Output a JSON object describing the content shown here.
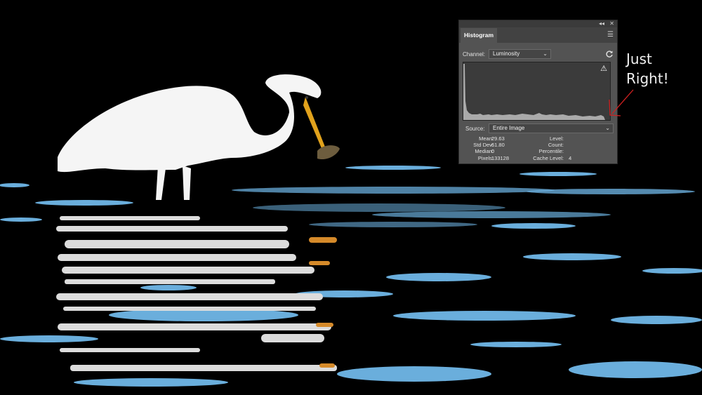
{
  "panel": {
    "tab_title": "Histogram",
    "collapse_glyph": "◂◂",
    "close_glyph": "✕",
    "menu_glyph": "☰",
    "channel_label": "Channel:",
    "channel_value": "Luminosity",
    "refresh_icon": "refresh-icon",
    "warning_glyph": "⚠",
    "source_label": "Source:",
    "source_value": "Entire Image",
    "stats": {
      "mean_label": "Mean:",
      "mean": "29.63",
      "stddev_label": "Std Dev:",
      "stddev": "61.80",
      "median_label": "Median:",
      "median": "0",
      "pixels_label": "Pixels:",
      "pixels": "133128",
      "level_label": "Level:",
      "level": "",
      "count_label": "Count:",
      "count": "",
      "percentile_label": "Percentile:",
      "percentile": "",
      "cache_label": "Cache Level:",
      "cache": "4"
    }
  },
  "annotation": {
    "line1": "Just",
    "line2": "Right!",
    "color": "#d02020"
  },
  "colors": {
    "water_highlight": "#6aaedc",
    "panel_bg": "#535353"
  }
}
